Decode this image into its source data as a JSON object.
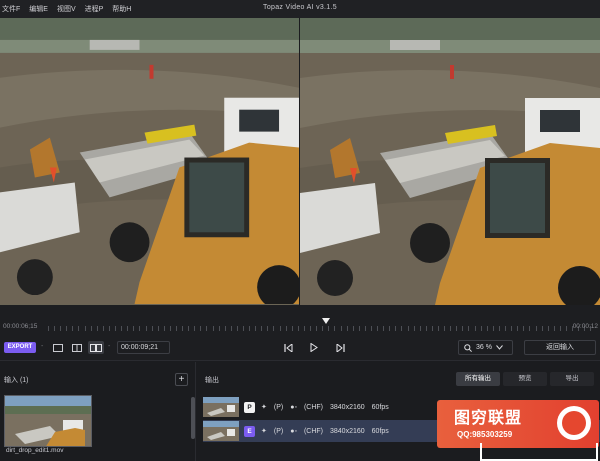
{
  "menu": {
    "items": [
      "文件F",
      "编辑E",
      "视图V",
      "进程P",
      "帮助H"
    ]
  },
  "app_title": "Topaz Video AI  v3.1.5",
  "timeline": {
    "start_time": "00:00:06;15",
    "end_time": "00:00:12",
    "playhead_fraction": 0.5
  },
  "controls": {
    "export_label": "EXPORT",
    "timecode": "00:00:09;21",
    "zoom_value": "36 %",
    "back_to_input_label": "返回输入"
  },
  "input_panel": {
    "title": "输入 (1)",
    "add_label": "+",
    "file_name": "dirt_drop_edit1.mov"
  },
  "output_panel": {
    "title": "输出",
    "tabs": [
      "所有输出",
      "预览",
      "导出"
    ],
    "rows": [
      {
        "badge": "P",
        "model": "(P)",
        "codec": "(CHF)",
        "resolution": "3840x2160",
        "fps": "60fps",
        "selected": false
      },
      {
        "badge": "E",
        "model": "(P)",
        "codec": "(CHF)",
        "resolution": "3840x2160",
        "fps": "60fps",
        "selected": true
      }
    ]
  },
  "watermark": {
    "title": "图穷联盟",
    "subtitle": "QQ:985303259"
  },
  "colors": {
    "accent": "#7b5cf0",
    "background": "#1b1c1f",
    "selected_row": "#343d55",
    "watermark": "#e5472f"
  }
}
